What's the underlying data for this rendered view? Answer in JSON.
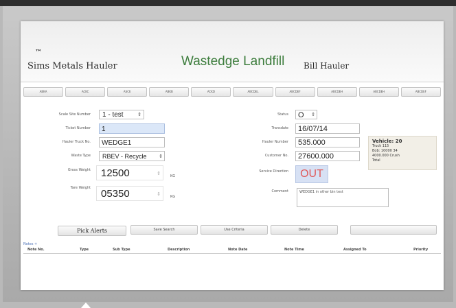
{
  "header": {
    "logo_text": "ᵀᴹ",
    "left_hauler": "Sims Metals Hauler",
    "title": "Wastedge Landfill",
    "right_hauler": "Bill Hauler"
  },
  "tabs": [
    "ABKA",
    "ACKC",
    "ASCE",
    "ABKB",
    "ACKD",
    "ABCDEL",
    "ABCDEF",
    "ABCDEH",
    "ABCDEH",
    "ABCDEF"
  ],
  "form": {
    "scale_site_label": "Scale Site Number",
    "scale_site_value": "1 - test",
    "ticket_number_label": "Ticket Number",
    "ticket_number_value": "1",
    "hauler_truck_label": "Hauler Truck No.",
    "hauler_truck_value": "WEDGE1",
    "waste_type_label": "Waste Type",
    "waste_type_value": "RBEV - Recycle",
    "gross_weight_label": "Gross Weight",
    "gross_weight_value": "12500",
    "gross_weight_unit": "KG",
    "tare_weight_label": "Tare Weight",
    "tare_weight_value": "05350",
    "tare_weight_unit": "KG",
    "status_label": "Status",
    "status_value": "O",
    "transdate_label": "Transdate",
    "transdate_value": "16/07/14",
    "hauler_number_label": "Hauler Number",
    "hauler_number_value": "535.000",
    "customer_no_label": "Customer No.",
    "customer_no_value": "27600.000",
    "service_direction_label": "Service Direction",
    "service_direction_value": "OUT",
    "comment_label": "Comment",
    "comment_value": "WEDGE1 in other bin test"
  },
  "info": {
    "line1": "Vehicle: 20",
    "line2": "Truck 115",
    "line3": "Bob: 10000  34",
    "line4": "4000.000  Crush",
    "line5": "Total"
  },
  "buttons": {
    "pick_alerts": "Pick Alerts",
    "save_search": "Save Search",
    "use_criteria": "Use Criteria",
    "delete": "Delete"
  },
  "table": {
    "notes_link": "Notes +",
    "columns": [
      "Note No.",
      "Type",
      "Sub Type",
      "Description",
      "Note Date",
      "Note Time",
      "Assigned To",
      "Priority"
    ]
  },
  "colors": {
    "title_green": "#3d7d3d",
    "out_red": "#e05a5a",
    "highlight_blue": "#dbe7f8"
  }
}
